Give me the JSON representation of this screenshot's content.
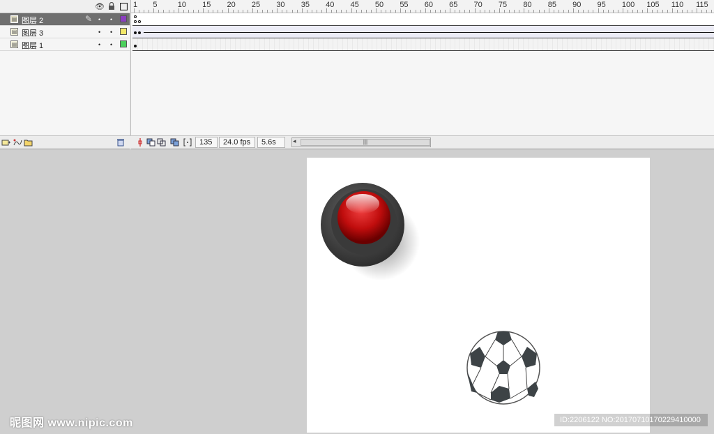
{
  "timeline": {
    "header_icons": [
      "eye-icon",
      "lock-icon",
      "outline-icon"
    ],
    "ruler_labels": [
      "1",
      "5",
      "10",
      "15",
      "20",
      "25",
      "30",
      "35",
      "40",
      "45",
      "50",
      "55",
      "60",
      "65",
      "70",
      "75",
      "80",
      "85",
      "90",
      "95",
      "100",
      "105",
      "110",
      "115"
    ],
    "layers": [
      {
        "name": "图层 2",
        "color": "#8b3fbf",
        "active": true
      },
      {
        "name": "图层 3",
        "color": "#f2e86a",
        "active": false
      },
      {
        "name": "图层 1",
        "color": "#4cd05c",
        "active": false
      }
    ],
    "current_frame": "135",
    "fps": "24.0 fps",
    "time": "5.6s"
  },
  "stage": {
    "objects": [
      "red-button-graphic",
      "soccer-ball-graphic"
    ]
  },
  "watermark": {
    "left": "昵图网 www.nipic.com",
    "right": "ID:2206122 NO:20170710170229410000"
  }
}
